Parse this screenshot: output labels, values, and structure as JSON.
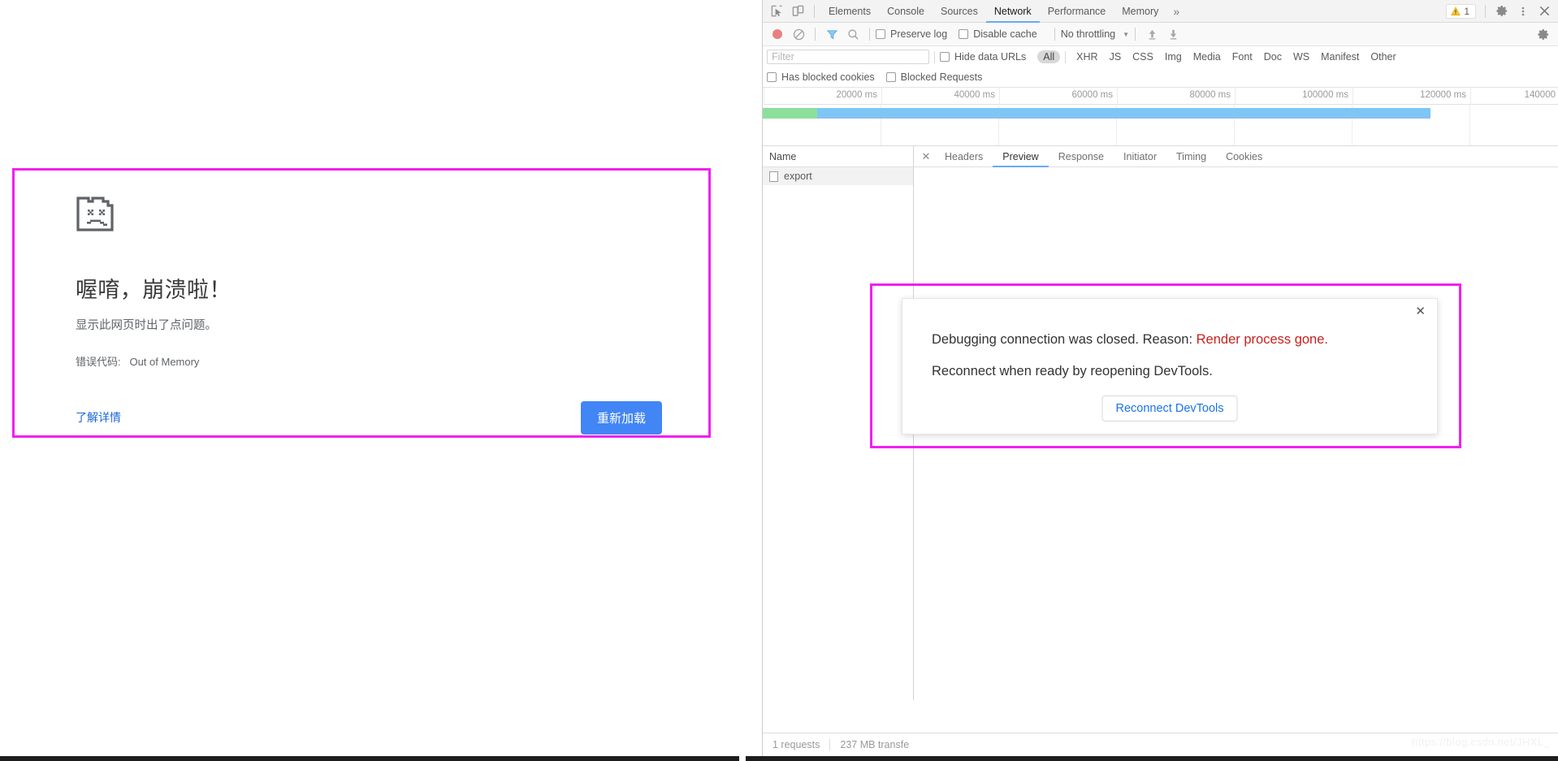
{
  "crash_page": {
    "icon": "sad-page-icon",
    "title": "喔唷，崩溃啦！",
    "subtitle": "显示此网页时出了点问题。",
    "error_code_label": "错误代码:",
    "error_code_value": "Out of Memory",
    "learn_more": "了解详情",
    "reload_button": "重新加载",
    "accent_color": "#4285f4",
    "link_color": "#1967d2",
    "highlight_color": "#f020f0"
  },
  "devtools": {
    "tabbar": {
      "inspect_icon": "inspect-cursor-icon",
      "device_icon": "device-toolbar-icon",
      "tabs": [
        {
          "label": "Elements",
          "active": false
        },
        {
          "label": "Console",
          "active": false
        },
        {
          "label": "Sources",
          "active": false
        },
        {
          "label": "Network",
          "active": true
        },
        {
          "label": "Performance",
          "active": false
        },
        {
          "label": "Memory",
          "active": false
        }
      ],
      "more_tabs_icon": "chevron-double-right-icon",
      "warning_icon": "warning-triangle-icon",
      "warning_count": "1",
      "settings_icon": "gear-icon",
      "more_icon": "kebab-menu-icon",
      "close_icon": "close-icon"
    },
    "toolbar": {
      "record_icon": "record-circle-icon",
      "clear_icon": "clear-no-entry-icon",
      "filter_icon": "filter-funnel-icon",
      "search_icon": "search-icon",
      "preserve_log": "Preserve log",
      "disable_cache": "Disable cache",
      "throttling": "No throttling",
      "import_icon": "import-har-up-arrow-icon",
      "export_icon": "export-har-down-arrow-icon",
      "settings_icon": "network-settings-gear-icon"
    },
    "filterbar": {
      "filter_placeholder": "Filter",
      "filter_value": "",
      "hide_data_urls": "Hide data URLs",
      "types": [
        "All",
        "XHR",
        "JS",
        "CSS",
        "Img",
        "Media",
        "Font",
        "Doc",
        "WS",
        "Manifest",
        "Other"
      ],
      "selected_type": "All"
    },
    "blockedbar": {
      "has_blocked_cookies": "Has blocked cookies",
      "blocked_requests": "Blocked Requests"
    },
    "overview": {
      "ticks": [
        "20000 ms",
        "40000 ms",
        "60000 ms",
        "80000 ms",
        "100000 ms",
        "120000 ms",
        "140000"
      ],
      "bar_total_pct": 84,
      "bar_green_pct": 6.8,
      "bar_color": "#7cc7f5",
      "bar_green_color": "#8ce09b"
    },
    "request_list": {
      "column_header": "Name",
      "rows": [
        {
          "name": "export",
          "icon": "document-icon",
          "selected": true
        }
      ]
    },
    "detail": {
      "close_icon": "close-icon",
      "tabs": [
        {
          "label": "Headers",
          "active": false
        },
        {
          "label": "Preview",
          "active": true
        },
        {
          "label": "Response",
          "active": false
        },
        {
          "label": "Initiator",
          "active": false
        },
        {
          "label": "Timing",
          "active": false
        },
        {
          "label": "Cookies",
          "active": false
        }
      ]
    },
    "status": {
      "requests": "1 requests",
      "transferred": "237 MB transfe"
    }
  },
  "modal": {
    "close_icon": "close-icon",
    "line1_prefix": "Debugging connection was closed. Reason: ",
    "line1_reason": "Render process gone.",
    "line2": "Reconnect when ready by reopening DevTools.",
    "button": "Reconnect DevTools",
    "reason_color": "#c5221f",
    "button_color": "#1a73e8",
    "highlight_color": "#f020f0"
  },
  "watermark": "https://blog.csdn.net/JHXL_"
}
